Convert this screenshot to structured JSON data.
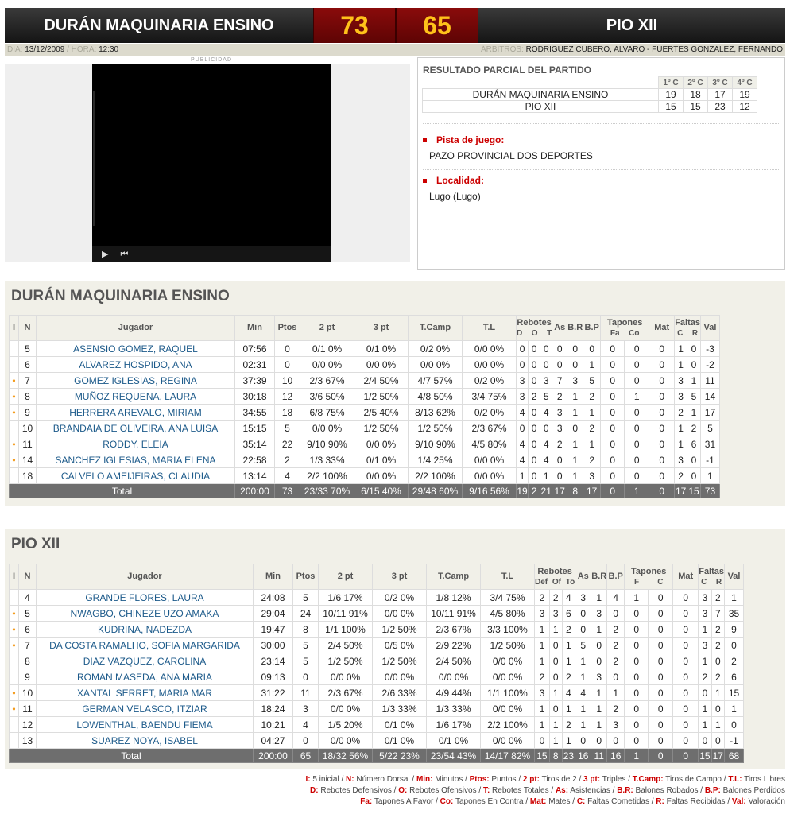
{
  "header": {
    "home_team": "DURÁN MAQUINARIA ENSINO",
    "home_score": "73",
    "away_score": "65",
    "away_team": "PIO XII"
  },
  "info": {
    "dia_label": "DÍA:",
    "dia": "13/12/2009",
    "hora_label": "/ HORA:",
    "hora": "12:30",
    "arbitros_label": "ÁRBITROS:",
    "arbitros": "RODRIGUEZ CUBERO, ALVARO - FUERTES GONZALEZ, FERNANDO"
  },
  "ad": {
    "label": "PUBLICIDAD",
    "play": "▶",
    "skip": "⏮"
  },
  "partial": {
    "title": "RESULTADO PARCIAL DEL PARTIDO",
    "quarters": [
      "1º C",
      "2º C",
      "3º C",
      "4º C"
    ],
    "rows": [
      {
        "team": "DURÁN MAQUINARIA ENSINO",
        "q": [
          "19",
          "18",
          "17",
          "19"
        ]
      },
      {
        "team": "PIO XII",
        "q": [
          "15",
          "15",
          "23",
          "12"
        ]
      }
    ]
  },
  "venue": {
    "pista_label": "Pista de juego:",
    "pista": "PAZO PROVINCIAL DOS DEPORTES",
    "localidad_label": "Localidad:",
    "localidad": "Lugo (Lugo)"
  },
  "colors": {
    "accent_red": "#cc0000",
    "score_yellow": "#ffc21a",
    "starter_dot": "#f39a1a"
  },
  "teams": [
    {
      "name": "DURÁN MAQUINARIA ENSINO",
      "headers": {
        "i": "I",
        "n": "N",
        "jugador": "Jugador",
        "min": "Min",
        "ptos": "Ptos",
        "t2": "2 pt",
        "t3": "3 pt",
        "tc": "T.Camp",
        "tl": "T.L",
        "reb": "Rebotes",
        "reb_sub": "D  O  T",
        "as": "As",
        "br": "B.R",
        "bp": "B.P",
        "tap": "Tapones",
        "tap_sub": "Fa  Co",
        "mat": "Mat",
        "faltas": "Faltas",
        "faltas_sub": "C  R",
        "val": "Val"
      },
      "players": [
        [
          "",
          "5",
          "ASENSIO GOMEZ, RAQUEL",
          "07:56",
          "0",
          "0/1 0%",
          "0/1 0%",
          "0/2 0%",
          "0/0 0%",
          "0",
          "0",
          "0",
          "0",
          "0",
          "0",
          "0",
          "0",
          "0",
          "1",
          "0",
          "-3"
        ],
        [
          "",
          "6",
          "ALVAREZ HOSPIDO, ANA",
          "02:31",
          "0",
          "0/0 0%",
          "0/0 0%",
          "0/0 0%",
          "0/0 0%",
          "0",
          "0",
          "0",
          "0",
          "0",
          "1",
          "0",
          "0",
          "0",
          "1",
          "0",
          "-2"
        ],
        [
          "•",
          "7",
          "GOMEZ IGLESIAS, REGINA",
          "37:39",
          "10",
          "2/3 67%",
          "2/4 50%",
          "4/7 57%",
          "0/2 0%",
          "3",
          "0",
          "3",
          "7",
          "3",
          "5",
          "0",
          "0",
          "0",
          "3",
          "1",
          "11"
        ],
        [
          "•",
          "8",
          "MUÑOZ REQUENA, LAURA",
          "30:18",
          "12",
          "3/6 50%",
          "1/2 50%",
          "4/8 50%",
          "3/4 75%",
          "3",
          "2",
          "5",
          "2",
          "1",
          "2",
          "0",
          "1",
          "0",
          "3",
          "5",
          "14"
        ],
        [
          "•",
          "9",
          "HERRERA AREVALO, MIRIAM",
          "34:55",
          "18",
          "6/8 75%",
          "2/5 40%",
          "8/13 62%",
          "0/2 0%",
          "4",
          "0",
          "4",
          "3",
          "1",
          "1",
          "0",
          "0",
          "0",
          "2",
          "1",
          "17"
        ],
        [
          "",
          "10",
          "BRANDAIA DE OLIVEIRA, ANA LUISA",
          "15:15",
          "5",
          "0/0 0%",
          "1/2 50%",
          "1/2 50%",
          "2/3 67%",
          "0",
          "0",
          "0",
          "3",
          "0",
          "2",
          "0",
          "0",
          "0",
          "1",
          "2",
          "5"
        ],
        [
          "•",
          "11",
          "RODDY, ELEIA",
          "35:14",
          "22",
          "9/10 90%",
          "0/0 0%",
          "9/10 90%",
          "4/5 80%",
          "4",
          "0",
          "4",
          "2",
          "1",
          "1",
          "0",
          "0",
          "0",
          "1",
          "6",
          "31"
        ],
        [
          "•",
          "14",
          "SANCHEZ IGLESIAS, MARIA ELENA",
          "22:58",
          "2",
          "1/3 33%",
          "0/1 0%",
          "1/4 25%",
          "0/0 0%",
          "4",
          "0",
          "4",
          "0",
          "1",
          "2",
          "0",
          "0",
          "0",
          "3",
          "0",
          "-1"
        ],
        [
          "",
          "18",
          "CALVELO AMEIJEIRAS, CLAUDIA",
          "13:14",
          "4",
          "2/2 100%",
          "0/0 0%",
          "2/2 100%",
          "0/0 0%",
          "1",
          "0",
          "1",
          "0",
          "1",
          "3",
          "0",
          "0",
          "0",
          "2",
          "0",
          "1"
        ]
      ],
      "total": [
        "Total",
        "200:00",
        "73",
        "23/33 70%",
        "6/15 40%",
        "29/48 60%",
        "9/16 56%",
        "19",
        "2",
        "21",
        "17",
        "8",
        "17",
        "0",
        "1",
        "0",
        "17",
        "15",
        "73"
      ]
    },
    {
      "name": "PIO XII",
      "headers": {
        "i": "I",
        "n": "N",
        "jugador": "Jugador",
        "min": "Min",
        "ptos": "Ptos",
        "t2": "2 pt",
        "t3": "3 pt",
        "tc": "T.Camp",
        "tl": "T.L",
        "reb": "Rebotes",
        "reb_sub": "Def Of To",
        "as": "As",
        "br": "B.R",
        "bp": "B.P",
        "tap": "Tapones",
        "tap_sub": "F    C",
        "mat": "Mat",
        "faltas": "Faltas",
        "faltas_sub": "C  R",
        "val": "Val"
      },
      "players": [
        [
          "",
          "4",
          "GRANDE FLORES, LAURA",
          "24:08",
          "5",
          "1/6 17%",
          "0/2 0%",
          "1/8 12%",
          "3/4 75%",
          "2",
          "2",
          "4",
          "3",
          "1",
          "4",
          "1",
          "0",
          "0",
          "3",
          "2",
          "1"
        ],
        [
          "•",
          "5",
          "NWAGBO, CHINEZE UZO AMAKA",
          "29:04",
          "24",
          "10/11 91%",
          "0/0 0%",
          "10/11 91%",
          "4/5 80%",
          "3",
          "3",
          "6",
          "0",
          "3",
          "0",
          "0",
          "0",
          "0",
          "3",
          "7",
          "35"
        ],
        [
          "•",
          "6",
          "KUDRINA, NADEZDA",
          "19:47",
          "8",
          "1/1 100%",
          "1/2 50%",
          "2/3 67%",
          "3/3 100%",
          "1",
          "1",
          "2",
          "0",
          "1",
          "2",
          "0",
          "0",
          "0",
          "1",
          "2",
          "9"
        ],
        [
          "•",
          "7",
          "DA COSTA RAMALHO, SOFIA MARGARIDA",
          "30:00",
          "5",
          "2/4 50%",
          "0/5 0%",
          "2/9 22%",
          "1/2 50%",
          "1",
          "0",
          "1",
          "5",
          "0",
          "2",
          "0",
          "0",
          "0",
          "3",
          "2",
          "0"
        ],
        [
          "",
          "8",
          "DIAZ VAZQUEZ, CAROLINA",
          "23:14",
          "5",
          "1/2 50%",
          "1/2 50%",
          "2/4 50%",
          "0/0 0%",
          "1",
          "0",
          "1",
          "1",
          "0",
          "2",
          "0",
          "0",
          "0",
          "1",
          "0",
          "2"
        ],
        [
          "",
          "9",
          "ROMAN MASEDA, ANA MARIA",
          "09:13",
          "0",
          "0/0 0%",
          "0/0 0%",
          "0/0 0%",
          "0/0 0%",
          "2",
          "0",
          "2",
          "1",
          "3",
          "0",
          "0",
          "0",
          "0",
          "2",
          "2",
          "6"
        ],
        [
          "•",
          "10",
          "XANTAL SERRET, MARIA MAR",
          "31:22",
          "11",
          "2/3 67%",
          "2/6 33%",
          "4/9 44%",
          "1/1 100%",
          "3",
          "1",
          "4",
          "4",
          "1",
          "1",
          "0",
          "0",
          "0",
          "0",
          "1",
          "15"
        ],
        [
          "•",
          "11",
          "GERMAN VELASCO, ITZIAR",
          "18:24",
          "3",
          "0/0 0%",
          "1/3 33%",
          "1/3 33%",
          "0/0 0%",
          "1",
          "0",
          "1",
          "1",
          "1",
          "2",
          "0",
          "0",
          "0",
          "1",
          "0",
          "1"
        ],
        [
          "",
          "12",
          "LOWENTHAL, BAENDU FIEMA",
          "10:21",
          "4",
          "1/5 20%",
          "0/1 0%",
          "1/6 17%",
          "2/2 100%",
          "1",
          "1",
          "2",
          "1",
          "1",
          "3",
          "0",
          "0",
          "0",
          "1",
          "1",
          "0"
        ],
        [
          "",
          "13",
          "SUAREZ NOYA, ISABEL",
          "04:27",
          "0",
          "0/0 0%",
          "0/1 0%",
          "0/1 0%",
          "0/0 0%",
          "0",
          "1",
          "1",
          "0",
          "0",
          "0",
          "0",
          "0",
          "0",
          "0",
          "0",
          "-1"
        ]
      ],
      "total": [
        "Total",
        "200:00",
        "65",
        "18/32 56%",
        "5/22 23%",
        "23/54 43%",
        "14/17 82%",
        "15",
        "8",
        "23",
        "16",
        "11",
        "16",
        "1",
        "0",
        "0",
        "15",
        "17",
        "68"
      ]
    }
  ],
  "legend": [
    [
      [
        "I:",
        " 5 inicial / "
      ],
      [
        "N:",
        " Número Dorsal / "
      ],
      [
        "Min:",
        " Minutos / "
      ],
      [
        "Ptos:",
        " Puntos / "
      ],
      [
        "2 pt:",
        " Tiros de 2 / "
      ],
      [
        "3 pt:",
        " Triples / "
      ],
      [
        "T.Camp:",
        " Tiros de Campo / "
      ],
      [
        "T.L:",
        " Tiros Libres"
      ]
    ],
    [
      [
        "D:",
        " Rebotes Defensivos / "
      ],
      [
        "O:",
        " Rebotes Ofensivos / "
      ],
      [
        "T:",
        " Rebotes Totales / "
      ],
      [
        "As:",
        " Asistencias / "
      ],
      [
        "B.R:",
        " Balones Robados / "
      ],
      [
        "B.P:",
        " Balones Perdidos"
      ]
    ],
    [
      [
        "Fa:",
        " Tapones A Favor / "
      ],
      [
        "Co:",
        " Tapones En Contra / "
      ],
      [
        "Mat:",
        " Mates / "
      ],
      [
        "C:",
        " Faltas Cometidas / "
      ],
      [
        "R:",
        " Faltas Recibidas / "
      ],
      [
        "Val:",
        " Valoración"
      ]
    ]
  ]
}
